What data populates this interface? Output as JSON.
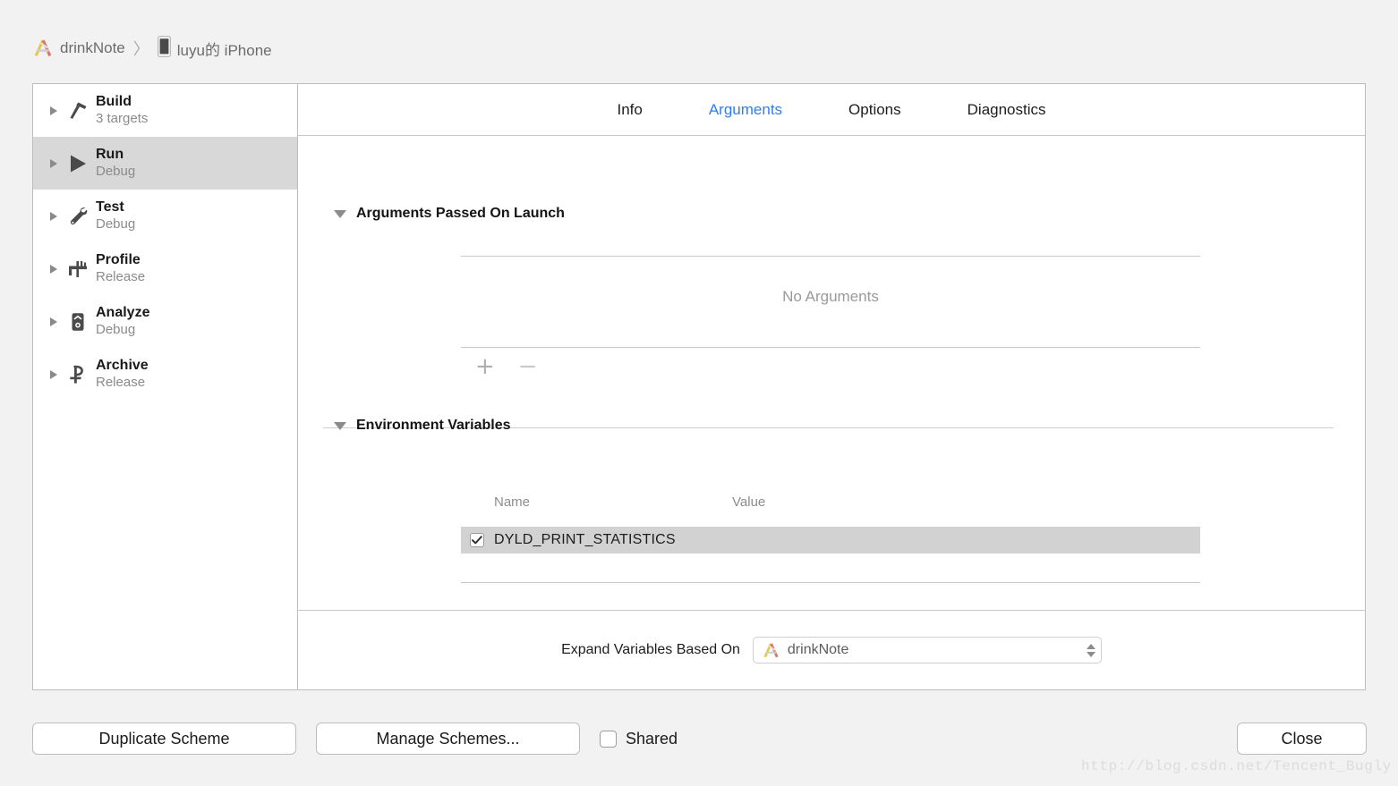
{
  "breadcrumb": {
    "project": "drinkNote",
    "separator": "〉",
    "device": "luyu的 iPhone",
    "project_icon": "xcode-project-icon",
    "device_icon": "iphone-device-icon"
  },
  "sidebar": {
    "items": [
      {
        "title": "Build",
        "subtitle": "3 targets",
        "icon": "hammer-icon",
        "selected": false
      },
      {
        "title": "Run",
        "subtitle": "Debug",
        "icon": "play-icon",
        "selected": true
      },
      {
        "title": "Test",
        "subtitle": "Debug",
        "icon": "wrench-icon",
        "selected": false
      },
      {
        "title": "Profile",
        "subtitle": "Release",
        "icon": "gauge-icon",
        "selected": false
      },
      {
        "title": "Analyze",
        "subtitle": "Debug",
        "icon": "analyze-icon",
        "selected": false
      },
      {
        "title": "Archive",
        "subtitle": "Release",
        "icon": "archive-icon",
        "selected": false
      }
    ]
  },
  "tabs": [
    {
      "label": "Info",
      "active": false
    },
    {
      "label": "Arguments",
      "active": true
    },
    {
      "label": "Options",
      "active": false
    },
    {
      "label": "Diagnostics",
      "active": false
    }
  ],
  "arguments_section": {
    "title": "Arguments Passed On Launch",
    "empty_text": "No Arguments",
    "add_label": "+",
    "remove_label": "−"
  },
  "env_section": {
    "title": "Environment Variables",
    "columns": {
      "name": "Name",
      "value": "Value"
    },
    "rows": [
      {
        "checked": true,
        "name": "DYLD_PRINT_STATISTICS",
        "value": ""
      }
    ],
    "add_label": "+",
    "remove_label": "−"
  },
  "expand": {
    "label": "Expand Variables Based On",
    "selected": "drinkNote",
    "icon": "xcode-project-icon",
    "stepper_icon": "stepper-updown-icon"
  },
  "bottom_bar": {
    "duplicate_label": "Duplicate Scheme",
    "manage_label": "Manage Schemes...",
    "shared_label": "Shared",
    "shared_checked": false,
    "close_label": "Close"
  },
  "watermark": "http://blog.csdn.net/Tencent_Bugly",
  "colors": {
    "accent": "#2f7fe8",
    "selection": "#d8d8d8",
    "row_selection": "#d2d2d2",
    "background": "#f2f2f2",
    "panel": "#ffffff",
    "border": "#bdbdbd"
  }
}
